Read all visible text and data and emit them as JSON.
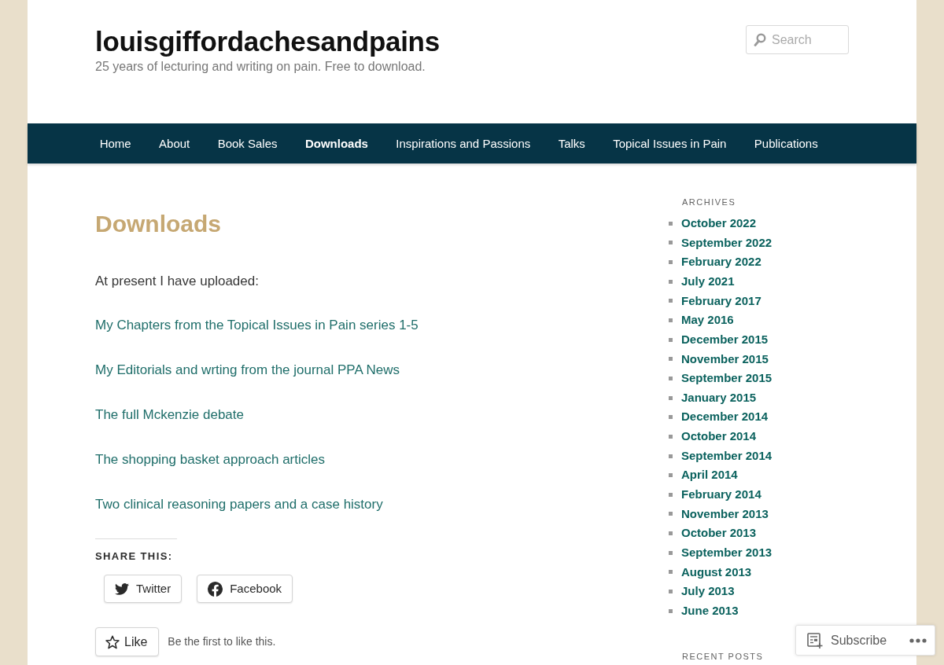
{
  "site": {
    "title": "louisgiffordachesandpains",
    "tagline": "25 years of lecturing and writing on pain. Free to download."
  },
  "search": {
    "placeholder": "Search"
  },
  "nav": [
    {
      "label": "Home",
      "selected": false
    },
    {
      "label": "About",
      "selected": false
    },
    {
      "label": "Book Sales",
      "selected": false
    },
    {
      "label": "Downloads",
      "selected": true
    },
    {
      "label": "Inspirations and Passions",
      "selected": false
    },
    {
      "label": "Talks",
      "selected": false
    },
    {
      "label": "Topical Issues in Pain",
      "selected": false
    },
    {
      "label": "Publications",
      "selected": false
    }
  ],
  "article": {
    "title": "Downloads",
    "intro": "At present I have uploaded:",
    "links": [
      "My Chapters from the Topical Issues in Pain series 1-5",
      "My Editorials and wrting from the journal PPA News",
      "The full Mckenzie debate",
      "The shopping basket approach articles",
      "Two clinical reasoning papers and a case history"
    ]
  },
  "share": {
    "heading": "SHARE THIS:",
    "buttons": [
      {
        "kind": "twitter",
        "label": "Twitter"
      },
      {
        "kind": "facebook",
        "label": "Facebook"
      }
    ]
  },
  "like": {
    "button": "Like",
    "text": "Be the first to like this."
  },
  "sidebar": {
    "archives": {
      "heading": "ARCHIVES",
      "items": [
        "October 2022",
        "September 2022",
        "February 2022",
        "July 2021",
        "February 2017",
        "May 2016",
        "December 2015",
        "November 2015",
        "September 2015",
        "January 2015",
        "December 2014",
        "October 2014",
        "September 2014",
        "April 2014",
        "February 2014",
        "November 2013",
        "October 2013",
        "September 2013",
        "August 2013",
        "July 2013",
        "June 2013"
      ]
    },
    "recent_posts": {
      "heading": "RECENT POSTS"
    }
  },
  "subscribe_bar": {
    "label": "Subscribe"
  }
}
